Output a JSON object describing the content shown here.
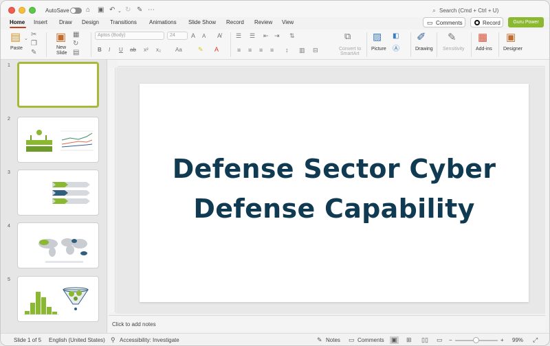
{
  "titlebar": {
    "autosave_label": "AutoSave",
    "search_placeholder": "Search (Cmd + Ctrl + U)"
  },
  "tabs": [
    "Home",
    "Insert",
    "Draw",
    "Design",
    "Transitions",
    "Animations",
    "Slide Show",
    "Record",
    "Review",
    "View"
  ],
  "header_buttons": {
    "comments": "Comments",
    "record": "Record",
    "guru": "Guru Power"
  },
  "ribbon": {
    "paste": "Paste",
    "new_slide_line1": "New",
    "new_slide_line2": "Slide",
    "font_name": "Aptos (Body)",
    "font_size": "24",
    "convert_line1": "Convert to",
    "convert_line2": "SmartArt",
    "picture": "Picture",
    "drawing": "Drawing",
    "sensitivity": "Sensitivity",
    "addins": "Add-ins",
    "designer": "Designer"
  },
  "slides": [
    {
      "number": "1"
    },
    {
      "number": "2"
    },
    {
      "number": "3"
    },
    {
      "number": "4"
    },
    {
      "number": "5"
    }
  ],
  "slide": {
    "title_line1": "Defense Sector Cyber",
    "title_line2": "Defense Capability"
  },
  "notes_placeholder": "Click to add notes",
  "statusbar": {
    "slide_position": "Slide 1 of 5",
    "language": "English (United States)",
    "accessibility": "Accessibility: Investigate",
    "notes": "Notes",
    "comments": "Comments",
    "zoom": "99%"
  },
  "colors": {
    "accent_tab": "#c43e1c",
    "guru_button": "#8ab831",
    "title_text": "#0f3a52",
    "thumb_selected": "#a8b83a"
  }
}
